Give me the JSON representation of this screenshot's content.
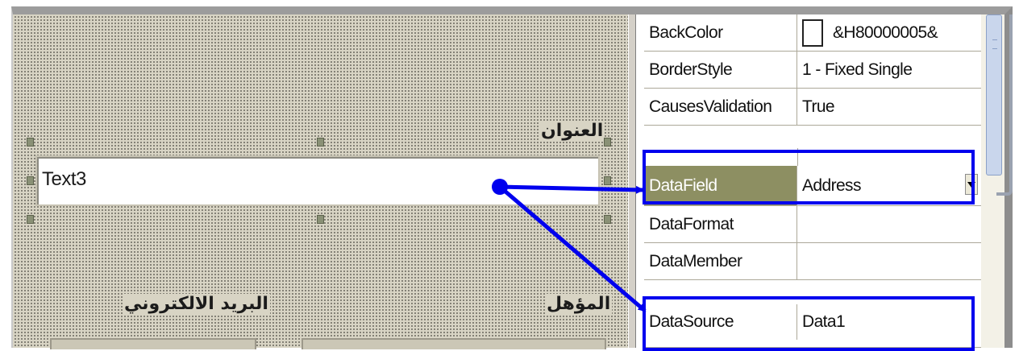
{
  "form": {
    "label_address": "العنوان",
    "label_email": "البريد الالكتروني",
    "label_qualification": "المؤهل",
    "textbox_value": "Text3"
  },
  "properties": {
    "rows": [
      {
        "name": "BackColor",
        "value": "&H80000005&"
      },
      {
        "name": "BorderStyle",
        "value": "1 - Fixed Single"
      },
      {
        "name": "CausesValidation",
        "value": "True"
      },
      {
        "name": "DataField",
        "value": "Address"
      },
      {
        "name": "DataFormat",
        "value": ""
      },
      {
        "name": "DataMember",
        "value": ""
      },
      {
        "name": "DataSource",
        "value": "Data1"
      }
    ],
    "selected": "DataField"
  },
  "colors": {
    "highlight_box": "#0000ee",
    "selected_row": "#8d8f62",
    "form_background": "#d8d4c4"
  },
  "icons": {
    "dropdown": "dropdown-arrow-icon",
    "color_swatch": "color-swatch-icon"
  }
}
